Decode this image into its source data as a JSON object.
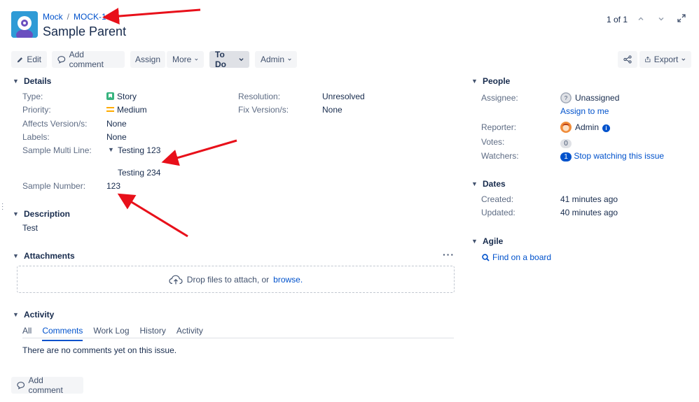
{
  "breadcrumb": {
    "project": "Mock",
    "issue_key": "MOCK-1"
  },
  "issue": {
    "title": "Sample Parent"
  },
  "pager": {
    "text": "1 of 1"
  },
  "toolbar": {
    "edit": "Edit",
    "add_comment": "Add comment",
    "assign": "Assign",
    "more": "More",
    "status": "To Do",
    "admin": "Admin",
    "export": "Export"
  },
  "details": {
    "heading": "Details",
    "type_label": "Type:",
    "type_value": "Story",
    "priority_label": "Priority:",
    "priority_value": "Medium",
    "affects_label": "Affects Version/s:",
    "affects_value": "None",
    "labels_label": "Labels:",
    "labels_value": "None",
    "multiline_label": "Sample Multi Line:",
    "multiline_value_1": "Testing 123",
    "multiline_value_2": "Testing 234",
    "number_label": "Sample Number:",
    "number_value": "123",
    "resolution_label": "Resolution:",
    "resolution_value": "Unresolved",
    "fixversion_label": "Fix Version/s:",
    "fixversion_value": "None"
  },
  "description": {
    "heading": "Description",
    "text": "Test"
  },
  "attachments": {
    "heading": "Attachments",
    "drop_text": "Drop files to attach, or",
    "browse": "browse."
  },
  "activity": {
    "heading": "Activity",
    "tabs": [
      "All",
      "Comments",
      "Work Log",
      "History",
      "Activity"
    ],
    "active_tab": "Comments",
    "empty": "There are no comments yet on this issue.",
    "add_comment": "Add comment"
  },
  "people": {
    "heading": "People",
    "assignee_label": "Assignee:",
    "assignee_value": "Unassigned",
    "assign_to_me": "Assign to me",
    "reporter_label": "Reporter:",
    "reporter_value": "Admin",
    "votes_label": "Votes:",
    "votes_value": "0",
    "watchers_label": "Watchers:",
    "watchers_count": "1",
    "watchers_value": "Stop watching this issue"
  },
  "dates": {
    "heading": "Dates",
    "created_label": "Created:",
    "created_value": "41 minutes ago",
    "updated_label": "Updated:",
    "updated_value": "40 minutes ago"
  },
  "agile": {
    "heading": "Agile",
    "find_on_board": "Find on a board"
  },
  "colors": {
    "link": "#0052cc",
    "annotation_arrow": "#e8101a",
    "story": "#36b37e",
    "priority_medium": "#ffab00"
  }
}
